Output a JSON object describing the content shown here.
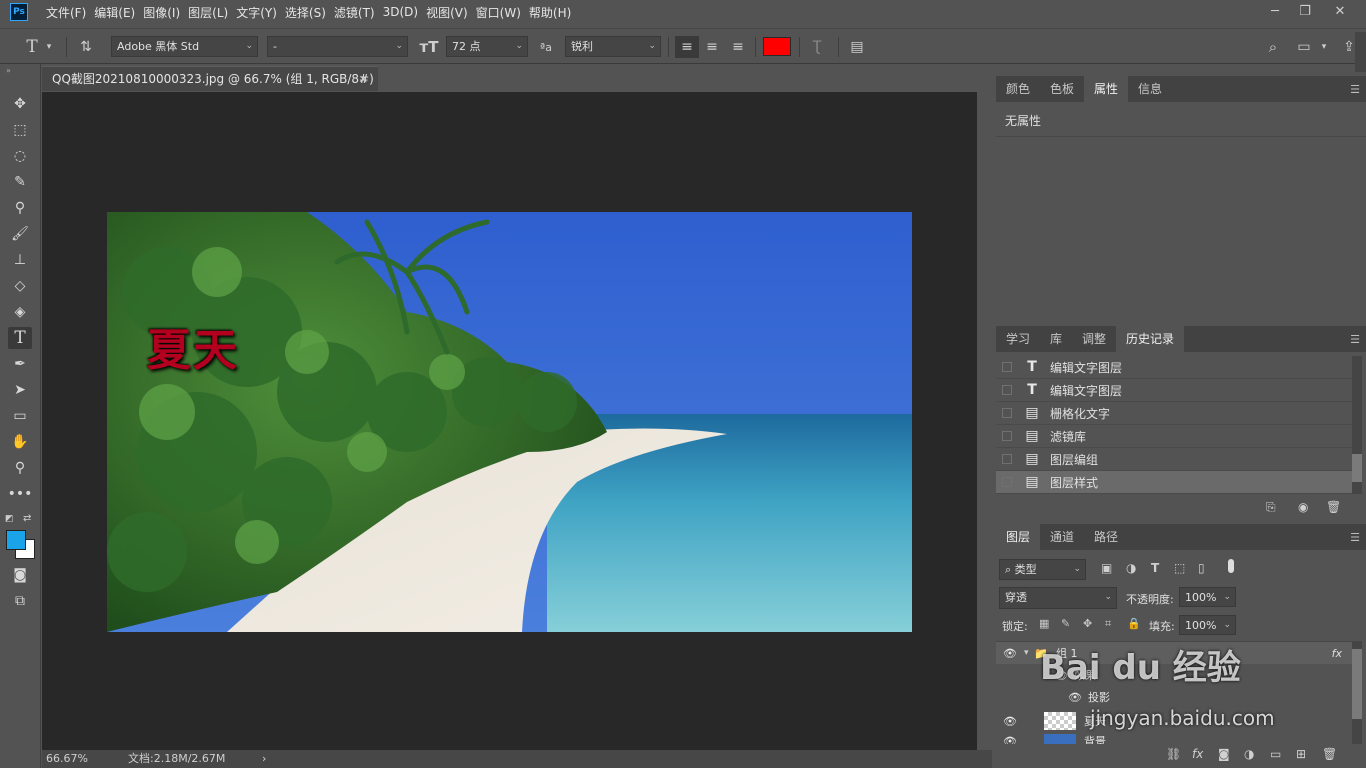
{
  "app": {
    "logo": "Ps"
  },
  "menu": [
    "文件(F)",
    "编辑(E)",
    "图像(I)",
    "图层(L)",
    "文字(Y)",
    "选择(S)",
    "滤镜(T)",
    "3D(D)",
    "视图(V)",
    "窗口(W)",
    "帮助(H)"
  ],
  "options": {
    "tool_icon": "T",
    "font_family": "Adobe 黑体 Std",
    "font_style": "-",
    "font_size": "72 点",
    "aa_label": "ªa",
    "antialias": "锐利",
    "text_color": "#ff0000"
  },
  "document": {
    "tab_title": "QQ截图20210810000323.jpg @ 66.7% (组 1, RGB/8#) *",
    "overlay_text": "夏天",
    "zoom": "66.67%",
    "doc_size": "文档:2.18M/2.67M"
  },
  "properties_panel": {
    "tabs": [
      "颜色",
      "色板",
      "属性",
      "信息"
    ],
    "active_tab": "属性",
    "content": "无属性"
  },
  "history_panel": {
    "tabs": [
      "学习",
      "库",
      "调整",
      "历史记录"
    ],
    "active_tab": "历史记录",
    "items": [
      {
        "label": "编辑文字图层",
        "icon": "T"
      },
      {
        "label": "编辑文字图层",
        "icon": "T"
      },
      {
        "label": "栅格化文字",
        "icon": "doc"
      },
      {
        "label": "滤镜库",
        "icon": "doc"
      },
      {
        "label": "图层编组",
        "icon": "doc"
      },
      {
        "label": "图层样式",
        "icon": "doc"
      }
    ]
  },
  "layers_panel": {
    "tabs": [
      "图层",
      "通道",
      "路径"
    ],
    "active_tab": "图层",
    "filter_label": "类型",
    "blend_mode": "穿透",
    "opacity_label": "不透明度:",
    "opacity": "100%",
    "lock_label": "锁定:",
    "fill_label": "填充:",
    "fill": "100%",
    "layers": [
      {
        "name": "组 1",
        "fx": "fx"
      },
      {
        "name": "效果"
      },
      {
        "name": "投影"
      },
      {
        "name": "夏天"
      },
      {
        "name": "背景"
      }
    ]
  },
  "watermark": {
    "brand": "Bai du 经验",
    "url": "jingyan.baidu.com"
  },
  "colors": {
    "foreground": "#1aa3e8",
    "background": "#ffffff"
  }
}
